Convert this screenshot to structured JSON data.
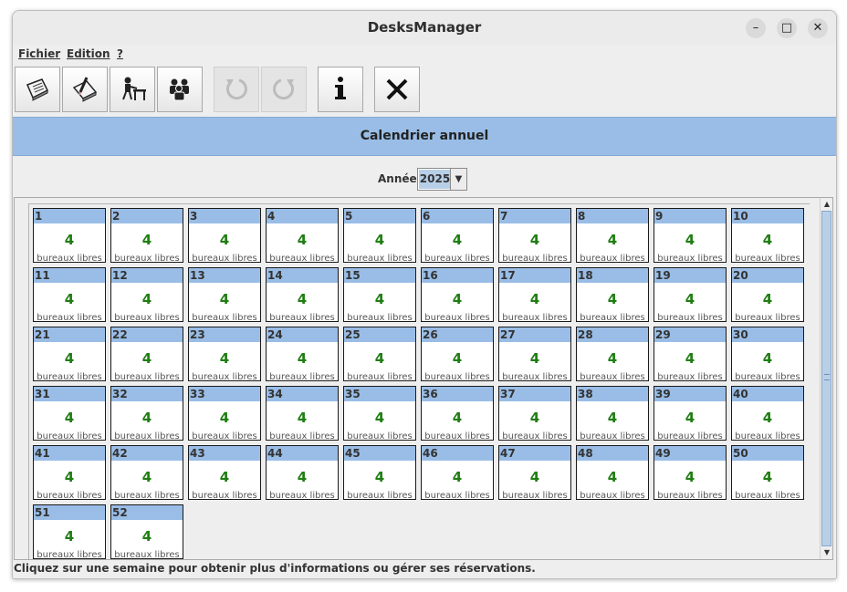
{
  "window": {
    "title": "DesksManager"
  },
  "window_controls": {
    "minimize": "–",
    "maximize": "□",
    "close": "✕"
  },
  "menubar": {
    "items": [
      "Fichier",
      "Edition",
      "?"
    ]
  },
  "toolbar": {
    "buttons": [
      {
        "icon": "book-icon",
        "enabled": true
      },
      {
        "icon": "notepad-pencil-icon",
        "enabled": true
      },
      {
        "icon": "person-at-desk-icon",
        "enabled": true
      },
      {
        "icon": "people-group-icon",
        "enabled": true
      },
      {
        "icon": "undo-icon",
        "enabled": false
      },
      {
        "icon": "redo-icon",
        "enabled": false
      },
      {
        "icon": "info-icon",
        "enabled": true
      },
      {
        "icon": "close-x-icon",
        "enabled": true
      }
    ]
  },
  "header": {
    "title": "Calendrier annuel"
  },
  "year_selector": {
    "label": "Année",
    "value": "2025"
  },
  "weeks": [
    {
      "week": "1",
      "free": "4",
      "label": "bureaux libres"
    },
    {
      "week": "2",
      "free": "4",
      "label": "bureaux libres"
    },
    {
      "week": "3",
      "free": "4",
      "label": "bureaux libres"
    },
    {
      "week": "4",
      "free": "4",
      "label": "bureaux libres"
    },
    {
      "week": "5",
      "free": "4",
      "label": "bureaux libres"
    },
    {
      "week": "6",
      "free": "4",
      "label": "bureaux libres"
    },
    {
      "week": "7",
      "free": "4",
      "label": "bureaux libres"
    },
    {
      "week": "8",
      "free": "4",
      "label": "bureaux libres"
    },
    {
      "week": "9",
      "free": "4",
      "label": "bureaux libres"
    },
    {
      "week": "10",
      "free": "4",
      "label": "bureaux libres"
    },
    {
      "week": "11",
      "free": "4",
      "label": "bureaux libres"
    },
    {
      "week": "12",
      "free": "4",
      "label": "bureaux libres"
    },
    {
      "week": "13",
      "free": "4",
      "label": "bureaux libres"
    },
    {
      "week": "14",
      "free": "4",
      "label": "bureaux libres"
    },
    {
      "week": "15",
      "free": "4",
      "label": "bureaux libres"
    },
    {
      "week": "16",
      "free": "4",
      "label": "bureaux libres"
    },
    {
      "week": "17",
      "free": "4",
      "label": "bureaux libres"
    },
    {
      "week": "18",
      "free": "4",
      "label": "bureaux libres"
    },
    {
      "week": "19",
      "free": "4",
      "label": "bureaux libres"
    },
    {
      "week": "20",
      "free": "4",
      "label": "bureaux libres"
    },
    {
      "week": "21",
      "free": "4",
      "label": "bureaux libres"
    },
    {
      "week": "22",
      "free": "4",
      "label": "bureaux libres"
    },
    {
      "week": "23",
      "free": "4",
      "label": "bureaux libres"
    },
    {
      "week": "24",
      "free": "4",
      "label": "bureaux libres"
    },
    {
      "week": "25",
      "free": "4",
      "label": "bureaux libres"
    },
    {
      "week": "26",
      "free": "4",
      "label": "bureaux libres"
    },
    {
      "week": "27",
      "free": "4",
      "label": "bureaux libres"
    },
    {
      "week": "28",
      "free": "4",
      "label": "bureaux libres"
    },
    {
      "week": "29",
      "free": "4",
      "label": "bureaux libres"
    },
    {
      "week": "30",
      "free": "4",
      "label": "bureaux libres"
    },
    {
      "week": "31",
      "free": "4",
      "label": "bureaux libres"
    },
    {
      "week": "32",
      "free": "4",
      "label": "bureaux libres"
    },
    {
      "week": "33",
      "free": "4",
      "label": "bureaux libres"
    },
    {
      "week": "34",
      "free": "4",
      "label": "bureaux libres"
    },
    {
      "week": "35",
      "free": "4",
      "label": "bureaux libres"
    },
    {
      "week": "36",
      "free": "4",
      "label": "bureaux libres"
    },
    {
      "week": "37",
      "free": "4",
      "label": "bureaux libres"
    },
    {
      "week": "38",
      "free": "4",
      "label": "bureaux libres"
    },
    {
      "week": "39",
      "free": "4",
      "label": "bureaux libres"
    },
    {
      "week": "40",
      "free": "4",
      "label": "bureaux libres"
    },
    {
      "week": "41",
      "free": "4",
      "label": "bureaux libres"
    },
    {
      "week": "42",
      "free": "4",
      "label": "bureaux libres"
    },
    {
      "week": "43",
      "free": "4",
      "label": "bureaux libres"
    },
    {
      "week": "44",
      "free": "4",
      "label": "bureaux libres"
    },
    {
      "week": "45",
      "free": "4",
      "label": "bureaux libres"
    },
    {
      "week": "46",
      "free": "4",
      "label": "bureaux libres"
    },
    {
      "week": "47",
      "free": "4",
      "label": "bureaux libres"
    },
    {
      "week": "48",
      "free": "4",
      "label": "bureaux libres"
    },
    {
      "week": "49",
      "free": "4",
      "label": "bureaux libres"
    },
    {
      "week": "50",
      "free": "4",
      "label": "bureaux libres"
    },
    {
      "week": "51",
      "free": "4",
      "label": "bureaux libres"
    },
    {
      "week": "52",
      "free": "4",
      "label": "bureaux libres"
    }
  ],
  "status_bar": {
    "text": "Cliquez sur une semaine pour obtenir plus d'informations ou gérer ses réservations."
  },
  "colors": {
    "header_bg": "#99bde6",
    "count_green": "#1f7d12",
    "cell_border": "#1a1a1a"
  }
}
